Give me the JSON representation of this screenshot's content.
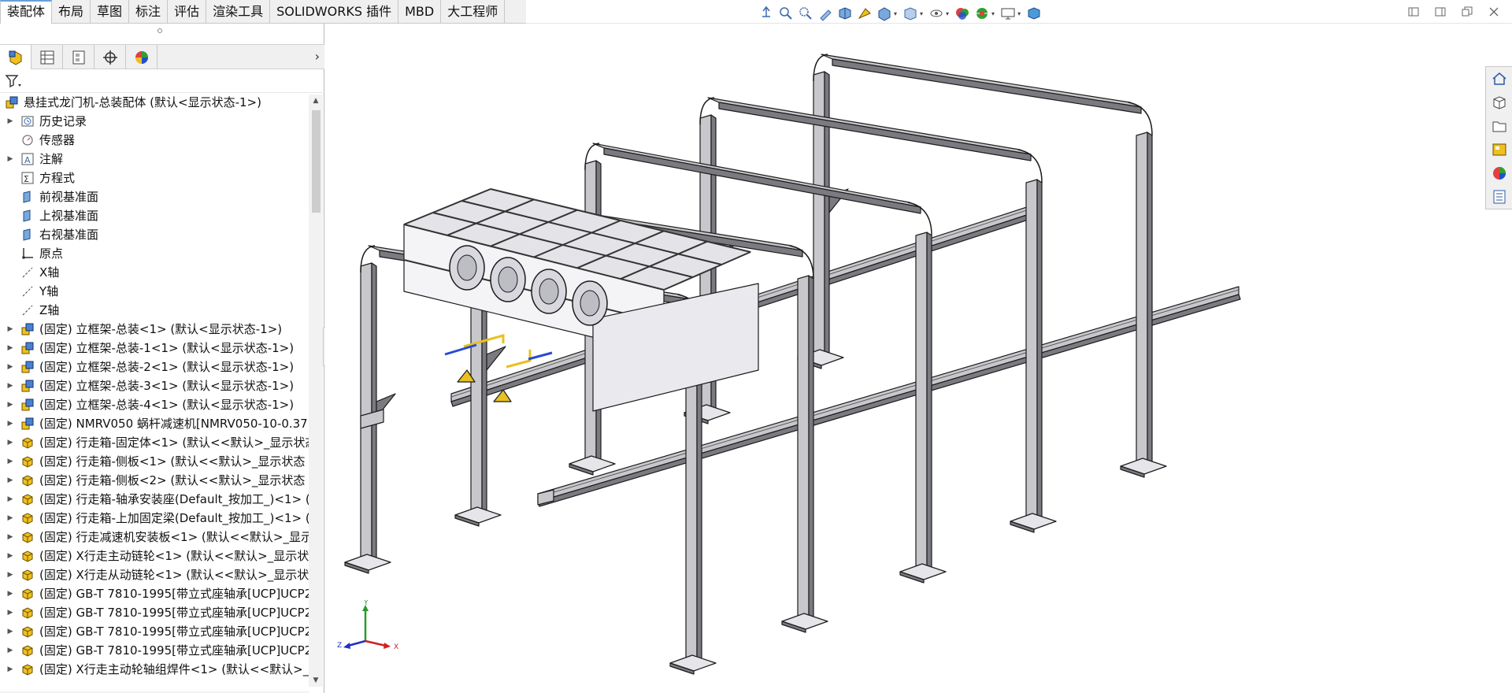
{
  "tabs": [
    "装配体",
    "布局",
    "草图",
    "标注",
    "评估",
    "渲染工具",
    "SOLIDWORKS 插件",
    "MBD",
    "大工程师"
  ],
  "active_tab": "装配体",
  "hud_icons": [
    "view-orientation-icon",
    "zoom-to-fit-icon",
    "zoom-to-area-icon",
    "previous-view-icon",
    "section-view-icon",
    "dynamic-annotation-icon",
    "view-orientation-dropdown-icon",
    "display-style-icon",
    "hide-show-items-icon",
    "edit-appearance-icon",
    "apply-scene-icon",
    "view-settings-icon",
    "3d-view-icon"
  ],
  "panel_tabs": [
    "featuremanager-tab",
    "propertymanager-tab",
    "configurationmanager-tab",
    "dimxpertmanager-tab",
    "displaymanager-tab"
  ],
  "tree": [
    {
      "label": "悬挂式龙门机-总装配体  (默认<显示状态-1>)",
      "icon": "assembly-icon",
      "level": 0,
      "expander": false
    },
    {
      "label": "历史记录",
      "icon": "history-icon",
      "level": 1,
      "expander": true
    },
    {
      "label": "传感器",
      "icon": "sensor-icon",
      "level": 1,
      "expander": false
    },
    {
      "label": "注解",
      "icon": "annotation-icon",
      "level": 1,
      "expander": true
    },
    {
      "label": "方程式",
      "icon": "equation-icon",
      "level": 1,
      "expander": false
    },
    {
      "label": "前视基准面",
      "icon": "plane-icon",
      "level": 1,
      "expander": false
    },
    {
      "label": "上视基准面",
      "icon": "plane-icon",
      "level": 1,
      "expander": false
    },
    {
      "label": "右视基准面",
      "icon": "plane-icon",
      "level": 1,
      "expander": false
    },
    {
      "label": "原点",
      "icon": "origin-icon",
      "level": 1,
      "expander": false
    },
    {
      "label": "X轴",
      "icon": "axis-icon",
      "level": 1,
      "expander": false
    },
    {
      "label": "Y轴",
      "icon": "axis-icon",
      "level": 1,
      "expander": false
    },
    {
      "label": "Z轴",
      "icon": "axis-icon",
      "level": 1,
      "expander": false
    },
    {
      "label": "(固定) 立框架-总装<1> (默认<显示状态-1>)",
      "icon": "subassembly-icon",
      "level": 1,
      "expander": true
    },
    {
      "label": "(固定) 立框架-总装-1<1> (默认<显示状态-1>)",
      "icon": "subassembly-icon",
      "level": 1,
      "expander": true
    },
    {
      "label": "(固定) 立框架-总装-2<1> (默认<显示状态-1>)",
      "icon": "subassembly-icon",
      "level": 1,
      "expander": true
    },
    {
      "label": "(固定) 立框架-总装-3<1> (默认<显示状态-1>)",
      "icon": "subassembly-icon",
      "level": 1,
      "expander": true
    },
    {
      "label": "(固定) 立框架-总装-4<1> (默认<显示状态-1>)",
      "icon": "subassembly-icon",
      "level": 1,
      "expander": true
    },
    {
      "label": "(固定) NMRV050 蜗杆减速机[NMRV050-10-0.37l",
      "icon": "subassembly-icon",
      "level": 1,
      "expander": true
    },
    {
      "label": "(固定) 行走箱-固定体<1> (默认<<默认>_显示状态",
      "icon": "part-icon",
      "level": 1,
      "expander": true
    },
    {
      "label": "(固定) 行走箱-侧板<1> (默认<<默认>_显示状态 1",
      "icon": "part-icon",
      "level": 1,
      "expander": true
    },
    {
      "label": "(固定) 行走箱-侧板<2> (默认<<默认>_显示状态 1",
      "icon": "part-icon",
      "level": 1,
      "expander": true
    },
    {
      "label": "(固定) 行走箱-轴承安装座(Default_按加工_)<1> (默",
      "icon": "part-icon",
      "level": 1,
      "expander": true
    },
    {
      "label": "(固定) 行走箱-上加固定梁(Default_按加工_)<1> (默",
      "icon": "part-icon",
      "level": 1,
      "expander": true
    },
    {
      "label": "(固定) 行走减速机安装板<1> (默认<<默认>_显示状",
      "icon": "part-icon",
      "level": 1,
      "expander": true
    },
    {
      "label": "(固定) X行走主动链轮<1> (默认<<默认>_显示状态",
      "icon": "part-icon",
      "level": 1,
      "expander": true
    },
    {
      "label": "(固定) X行走从动链轮<1> (默认<<默认>_显示状态",
      "icon": "part-icon",
      "level": 1,
      "expander": true
    },
    {
      "label": "(固定) GB-T 7810-1995[带立式座轴承[UCP]UCP2(",
      "icon": "part-icon",
      "level": 1,
      "expander": true
    },
    {
      "label": "(固定) GB-T 7810-1995[带立式座轴承[UCP]UCP2(",
      "icon": "part-icon",
      "level": 1,
      "expander": true
    },
    {
      "label": "(固定) GB-T 7810-1995[带立式座轴承[UCP]UCP2(",
      "icon": "part-icon",
      "level": 1,
      "expander": true
    },
    {
      "label": "(固定) GB-T 7810-1995[带立式座轴承[UCP]UCP2(",
      "icon": "part-icon",
      "level": 1,
      "expander": true
    },
    {
      "label": "(固定) X行走主动轮轴组焊件<1> (默认<<默认>_显",
      "icon": "part-icon",
      "level": 1,
      "expander": true
    }
  ],
  "task_pane": [
    "home-icon",
    "design-library-icon",
    "file-explorer-icon",
    "view-palette-icon",
    "appearances-icon",
    "custom-properties-icon"
  ],
  "triad": {
    "x": "X",
    "y": "Y",
    "z": "Z"
  },
  "colors": {
    "accent": "#6a9fd8",
    "frame": "#c8c8cc",
    "frame_dark": "#7a7a80",
    "edge": "#1c1c1c",
    "part_yellow": "#e8c020",
    "part_blue": "#2a4ad0"
  }
}
